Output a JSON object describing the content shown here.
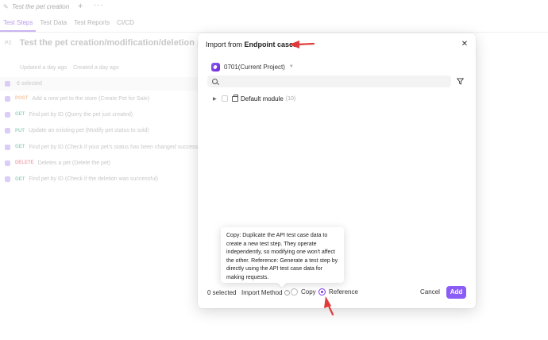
{
  "background": {
    "doc_title": "Test the pet creation",
    "tabs": [
      {
        "label": "Test Steps"
      },
      {
        "label": "Test Data"
      },
      {
        "label": "Test Reports"
      },
      {
        "label": "CI/CD"
      }
    ],
    "priority": "P2",
    "case_title": "Test the pet creation/modification/deletion process",
    "meta_updated": "Updated a day ago",
    "meta_created": "Created a day ago",
    "selected_text": "6 selected",
    "steps": [
      {
        "method": "POST",
        "text": "Add a new pet to the store (Create Pet for Sale)"
      },
      {
        "method": "GET",
        "text": "Find pet by ID (Query the pet just created)"
      },
      {
        "method": "PUT",
        "text": "Update an existing pet (Modify pet status to sold)"
      },
      {
        "method": "GET",
        "text": "Find pet by ID (Check if your pet's status has been changed successfully)"
      },
      {
        "method": "DELETE",
        "text": "Deletes a pet (Delete the pet)"
      },
      {
        "method": "GET",
        "text": "Find pet by ID (Check if the deletion was successful)"
      }
    ]
  },
  "modal": {
    "title_prefix": "Import from ",
    "title_bold": "Endpoint cases",
    "project": "0701(Current Project)",
    "search_placeholder": "",
    "tree": {
      "label": "Default module",
      "count": "(10)"
    },
    "footer": {
      "selected": "0 selected",
      "import_method_label": "Import Method",
      "copy_label": "Copy",
      "reference_label": "Reference",
      "selected_method": "Reference",
      "cancel_label": "Cancel",
      "add_label": "Add"
    },
    "tooltip": "Copy: Duplicate the API test case data to create a new test step. They operate independently, so modifying one won't affect the other. Reference: Generate a test step by directly using the API test case data for making requests."
  },
  "colors": {
    "accent": "#8b5cf6",
    "annotation_arrow": "#e03a3a"
  },
  "icons": [
    "pen-icon",
    "plus-icon",
    "more-icon",
    "project-icon",
    "chevron-down-icon",
    "search-icon",
    "filter-icon",
    "caret-right-icon",
    "folder-icon",
    "help-icon",
    "close-icon"
  ]
}
